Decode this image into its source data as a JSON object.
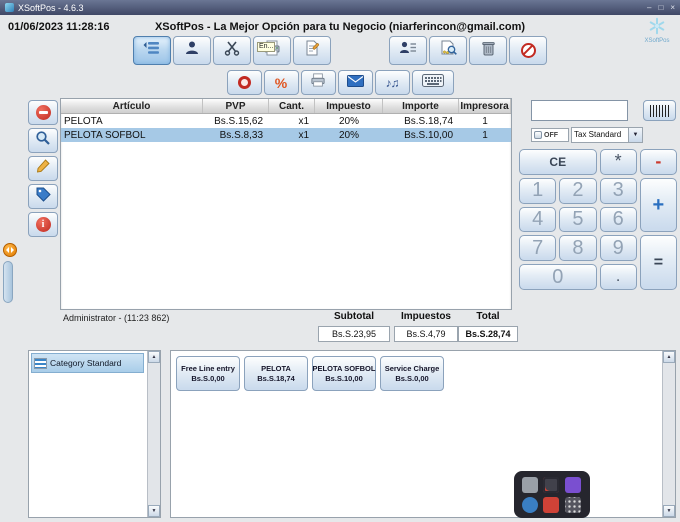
{
  "titlebar": {
    "title": "XSoftPos - 4.6.3",
    "minimize": "–",
    "maximize": "□",
    "close": "×"
  },
  "header": {
    "datetime": "01/06/2023 11:28:16",
    "title": "XSoftPos - La Mejor Opción para tu Negocio (niarferincon@gmail.com)",
    "logo_text": "XSoftPos"
  },
  "toolbar_main": {
    "print_overlay": "En..."
  },
  "toolbar_secondary": {
    "percent": "%",
    "notes": "♪♫"
  },
  "icons": {
    "info_glyph": "i",
    "dropdown_arrow": "▼",
    "scroll_up": "▲",
    "scroll_down": "▼"
  },
  "sale_table": {
    "columns": [
      "Artículo",
      "PVP",
      "Cant.",
      "Impuesto",
      "Importe",
      "Impresora"
    ],
    "rows": [
      {
        "articulo": "PELOTA",
        "pvp": "Bs.S.15,62",
        "cant": "x1",
        "impuesto": "20%",
        "importe": "Bs.S.18,74",
        "impresora": "1"
      },
      {
        "articulo": "PELOTA SOFBOL",
        "pvp": "Bs.S.8,33",
        "cant": "x1",
        "impuesto": "20%",
        "importe": "Bs.S.10,00",
        "impresora": "1"
      }
    ]
  },
  "status": {
    "operator": "Administrator - (11:23 862)"
  },
  "totals": {
    "subtotal_label": "Subtotal",
    "impuestos_label": "Impuestos",
    "total_label": "Total",
    "subtotal_value": "Bs.S.23,95",
    "impuestos_value": "Bs.S.4,79",
    "total_value": "Bs.S.28,74"
  },
  "right_panel": {
    "scan_value": "",
    "toggle_label": "OFF",
    "tax_selected": "Tax Standard"
  },
  "calculator": {
    "ce": "CE",
    "multiply": "*",
    "minus": "-",
    "plus": "+",
    "equals": "=",
    "dot": ".",
    "d1": "1",
    "d2": "2",
    "d3": "3",
    "d4": "4",
    "d5": "5",
    "d6": "6",
    "d7": "7",
    "d8": "8",
    "d9": "9",
    "d0": "0"
  },
  "categories": {
    "selected": "Category Standard"
  },
  "products": [
    {
      "name": "Free Line entry",
      "price": "Bs.S.0,00"
    },
    {
      "name": "PELOTA",
      "price": "Bs.S.18,74"
    },
    {
      "name": "PELOTA SOFBOL",
      "price": "Bs.S.10,00"
    },
    {
      "name": "Service Charge",
      "price": "Bs.S.0,00"
    }
  ],
  "colors": {
    "titlebar": "#3f4765",
    "accent_blue": "#2f6fc0",
    "selected_row": "#a6c9e6",
    "danger_red": "#cc2a2a",
    "warning_orange": "#e07b00"
  }
}
